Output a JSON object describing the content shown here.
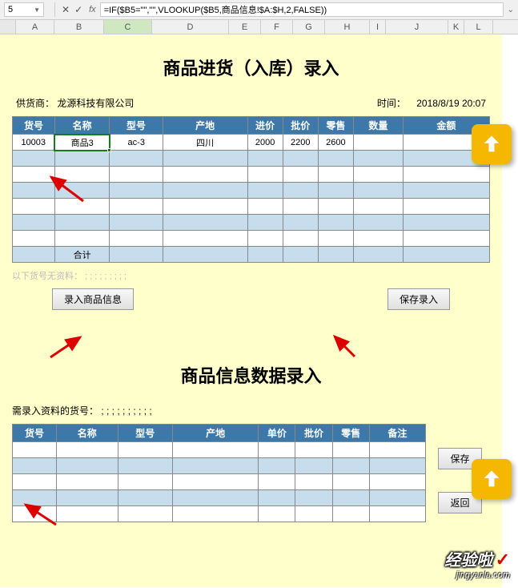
{
  "toolbar": {
    "name_box": "5",
    "formula": "=IF($B5=\"\",\"\",VLOOKUP($B5,商品信息!$A:$H,2,FALSE))"
  },
  "columns": [
    "A",
    "B",
    "C",
    "D",
    "E",
    "F",
    "G",
    "H",
    "I",
    "J",
    "K",
    "L"
  ],
  "title1": "商品进货（入库）录入",
  "supplier_label": "供货商：",
  "supplier_value": "龙源科技有限公司",
  "time_label": "时间：",
  "time_value": "2018/8/19 20:07",
  "headers1": [
    "货号",
    "名称",
    "型号",
    "产地",
    "进价",
    "批价",
    "零售",
    "数量",
    "金额"
  ],
  "row1": [
    "10003",
    "商品3",
    "ac-3",
    "四川",
    "2000",
    "2200",
    "2600",
    "",
    ""
  ],
  "total_label": "合计",
  "note_invalid": "以下货号无资料：",
  "note_invalid_tail": " ; ; ; ; ; ; ; ; ;",
  "btn_enter_info": "录入商品信息",
  "btn_save_entry": "保存录入",
  "title2": "商品信息数据录入",
  "note_need": "需录入资料的货号：",
  "note_need_tail": " ; ; ; ; ; ; ; ; ; ;",
  "headers2": [
    "货号",
    "名称",
    "型号",
    "产地",
    "单价",
    "批价",
    "零售",
    "备注"
  ],
  "btn_save": "保存",
  "btn_back": "返回",
  "watermark_main": "经验啦",
  "watermark_sub": "jingyanla.com"
}
